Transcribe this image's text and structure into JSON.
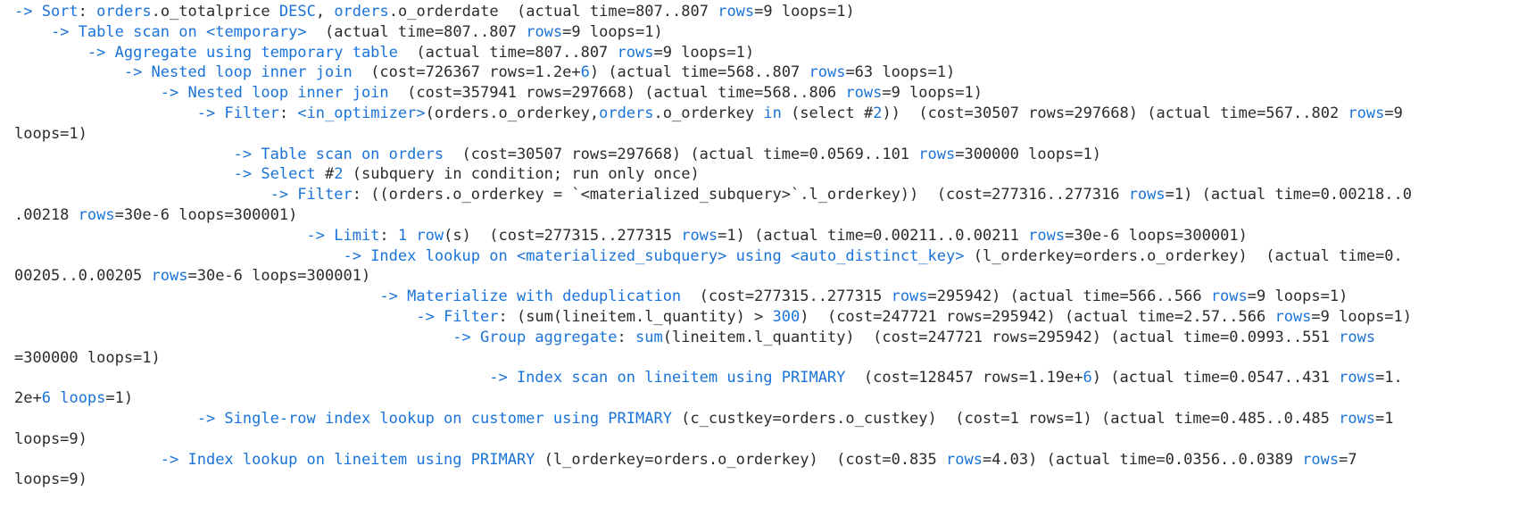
{
  "colors": {
    "text": "#1f1f1f",
    "keyword": "#1a73d9",
    "background": "#ffffff"
  },
  "lines": [
    {
      "indent": 0,
      "segs": [
        {
          "t": "-> ",
          "c": "k"
        },
        {
          "t": "Sort",
          "c": "k"
        },
        {
          "t": ": ",
          "c": "t"
        },
        {
          "t": "orders",
          "c": "k"
        },
        {
          "t": ".o_totalprice ",
          "c": "t"
        },
        {
          "t": "DESC",
          "c": "k"
        },
        {
          "t": ", ",
          "c": "t"
        },
        {
          "t": "orders",
          "c": "k"
        },
        {
          "t": ".o_orderdate  (actual time=807..807 ",
          "c": "t"
        },
        {
          "t": "rows",
          "c": "k"
        },
        {
          "t": "=9 loops=1)",
          "c": "t"
        }
      ]
    },
    {
      "indent": 4,
      "segs": [
        {
          "t": "-> ",
          "c": "k"
        },
        {
          "t": "Table scan on ",
          "c": "k"
        },
        {
          "t": "<temporary>",
          "c": "k"
        },
        {
          "t": "  (actual time=807..807 ",
          "c": "t"
        },
        {
          "t": "rows",
          "c": "k"
        },
        {
          "t": "=9 loops=1)",
          "c": "t"
        }
      ]
    },
    {
      "indent": 8,
      "segs": [
        {
          "t": "-> ",
          "c": "k"
        },
        {
          "t": "Aggregate using temporary table",
          "c": "k"
        },
        {
          "t": "  (actual time=807..807 ",
          "c": "t"
        },
        {
          "t": "rows",
          "c": "k"
        },
        {
          "t": "=9 loops=1)",
          "c": "t"
        }
      ]
    },
    {
      "indent": 12,
      "segs": [
        {
          "t": "-> ",
          "c": "k"
        },
        {
          "t": "Nested loop inner join",
          "c": "k"
        },
        {
          "t": "  (cost=726367 rows=1.2e+",
          "c": "t"
        },
        {
          "t": "6",
          "c": "k"
        },
        {
          "t": ") (actual time=568..807 ",
          "c": "t"
        },
        {
          "t": "rows",
          "c": "k"
        },
        {
          "t": "=63 loops=1)",
          "c": "t"
        }
      ]
    },
    {
      "indent": 16,
      "segs": [
        {
          "t": "-> ",
          "c": "k"
        },
        {
          "t": "Nested loop inner join",
          "c": "k"
        },
        {
          "t": "  (cost=357941 rows=297668) (actual time=568..806 ",
          "c": "t"
        },
        {
          "t": "rows",
          "c": "k"
        },
        {
          "t": "=9 loops=1)",
          "c": "t"
        }
      ]
    },
    {
      "indent": 20,
      "segs": [
        {
          "t": "-> ",
          "c": "k"
        },
        {
          "t": "Filter",
          "c": "k"
        },
        {
          "t": ": ",
          "c": "t"
        },
        {
          "t": "<in_optimizer>",
          "c": "k"
        },
        {
          "t": "(orders.o_orderkey,",
          "c": "t"
        },
        {
          "t": "orders",
          "c": "k"
        },
        {
          "t": ".o_orderkey ",
          "c": "t"
        },
        {
          "t": "in",
          "c": "k"
        },
        {
          "t": " (select #",
          "c": "t"
        },
        {
          "t": "2",
          "c": "n"
        },
        {
          "t": "))  (cost=30507 rows=297668) (actual time=567..802 ",
          "c": "t"
        },
        {
          "t": "rows",
          "c": "k"
        },
        {
          "t": "=9",
          "c": "t"
        }
      ]
    },
    {
      "indent": 0,
      "segs": [
        {
          "t": "loops=1)",
          "c": "t"
        }
      ]
    },
    {
      "indent": 24,
      "segs": [
        {
          "t": "-> ",
          "c": "k"
        },
        {
          "t": "Table scan on orders",
          "c": "k"
        },
        {
          "t": "  (cost=30507 rows=297668) (actual time=0.0569..101 ",
          "c": "t"
        },
        {
          "t": "rows",
          "c": "k"
        },
        {
          "t": "=300000 loops=1)",
          "c": "t"
        }
      ]
    },
    {
      "indent": 24,
      "segs": [
        {
          "t": "-> ",
          "c": "k"
        },
        {
          "t": "Select",
          "c": "k"
        },
        {
          "t": " #",
          "c": "t"
        },
        {
          "t": "2",
          "c": "n"
        },
        {
          "t": " (subquery in condition; run only once)",
          "c": "t"
        }
      ]
    },
    {
      "indent": 28,
      "segs": [
        {
          "t": "-> ",
          "c": "k"
        },
        {
          "t": "Filter",
          "c": "k"
        },
        {
          "t": ": ((orders.o_orderkey = `<materialized_subquery>`.l_orderkey))  (cost=277316..277316 ",
          "c": "t"
        },
        {
          "t": "rows",
          "c": "k"
        },
        {
          "t": "=1) (actual time=0.00218..0",
          "c": "t"
        }
      ]
    },
    {
      "indent": 0,
      "segs": [
        {
          "t": ".00218 ",
          "c": "t"
        },
        {
          "t": "rows",
          "c": "k"
        },
        {
          "t": "=30e-6 loops=300001)",
          "c": "t"
        }
      ]
    },
    {
      "indent": 32,
      "segs": [
        {
          "t": "-> ",
          "c": "k"
        },
        {
          "t": "Limit",
          "c": "k"
        },
        {
          "t": ": ",
          "c": "t"
        },
        {
          "t": "1 row",
          "c": "k"
        },
        {
          "t": "(s)  (cost=277315..277315 ",
          "c": "t"
        },
        {
          "t": "rows",
          "c": "k"
        },
        {
          "t": "=1) (actual time=0.00211..0.00211 ",
          "c": "t"
        },
        {
          "t": "rows",
          "c": "k"
        },
        {
          "t": "=30e-6 loops=300001)",
          "c": "t"
        }
      ]
    },
    {
      "indent": 36,
      "segs": [
        {
          "t": "-> ",
          "c": "k"
        },
        {
          "t": "Index lookup on ",
          "c": "k"
        },
        {
          "t": "<materialized_subquery>",
          "c": "k"
        },
        {
          "t": " using ",
          "c": "k"
        },
        {
          "t": "<auto_distinct_key>",
          "c": "k"
        },
        {
          "t": " (l_orderkey=orders.o_orderkey)  (actual time=0.",
          "c": "t"
        }
      ]
    },
    {
      "indent": 0,
      "segs": [
        {
          "t": "00205..0.00205 ",
          "c": "t"
        },
        {
          "t": "rows",
          "c": "k"
        },
        {
          "t": "=30e-6 loops=300001)",
          "c": "t"
        }
      ]
    },
    {
      "indent": 40,
      "segs": [
        {
          "t": "-> ",
          "c": "k"
        },
        {
          "t": "Materialize with deduplication",
          "c": "k"
        },
        {
          "t": "  (cost=277315..277315 ",
          "c": "t"
        },
        {
          "t": "rows",
          "c": "k"
        },
        {
          "t": "=295942) (actual time=566..566 ",
          "c": "t"
        },
        {
          "t": "rows",
          "c": "k"
        },
        {
          "t": "=9 loops=1)",
          "c": "t"
        }
      ]
    },
    {
      "indent": 44,
      "segs": [
        {
          "t": "-> ",
          "c": "k"
        },
        {
          "t": "Filter",
          "c": "k"
        },
        {
          "t": ": (sum(lineitem.l_quantity) > ",
          "c": "t"
        },
        {
          "t": "300",
          "c": "n"
        },
        {
          "t": ")  (cost=247721 rows=295942) (actual time=2.57..566 ",
          "c": "t"
        },
        {
          "t": "rows",
          "c": "k"
        },
        {
          "t": "=9 loops=1)",
          "c": "t"
        }
      ]
    },
    {
      "indent": 48,
      "segs": [
        {
          "t": "-> ",
          "c": "k"
        },
        {
          "t": "Group aggregate",
          "c": "k"
        },
        {
          "t": ": ",
          "c": "t"
        },
        {
          "t": "sum",
          "c": "k"
        },
        {
          "t": "(lineitem.l_quantity)  (cost=247721 rows=295942) (actual time=0.0993..551 ",
          "c": "t"
        },
        {
          "t": "rows",
          "c": "k"
        }
      ]
    },
    {
      "indent": 0,
      "segs": [
        {
          "t": "=300000 loops=1)",
          "c": "t"
        }
      ]
    },
    {
      "indent": 52,
      "segs": [
        {
          "t": "-> ",
          "c": "k"
        },
        {
          "t": "Index scan on lineitem using PRIMARY",
          "c": "k"
        },
        {
          "t": "  (cost=128457 rows=1.19e+",
          "c": "t"
        },
        {
          "t": "6",
          "c": "k"
        },
        {
          "t": ") (actual time=0.0547..431 ",
          "c": "t"
        },
        {
          "t": "rows",
          "c": "k"
        },
        {
          "t": "=1.",
          "c": "t"
        }
      ]
    },
    {
      "indent": 0,
      "segs": [
        {
          "t": "2e+",
          "c": "t"
        },
        {
          "t": "6",
          "c": "k"
        },
        {
          "t": " ",
          "c": "t"
        },
        {
          "t": "loops",
          "c": "k"
        },
        {
          "t": "=1)",
          "c": "t"
        }
      ]
    },
    {
      "indent": 20,
      "segs": [
        {
          "t": "-> ",
          "c": "k"
        },
        {
          "t": "Single-row index lookup on customer using PRIMARY",
          "c": "k"
        },
        {
          "t": " (c_custkey=orders.o_custkey)  (cost=1 rows=1) (actual time=0.485..0.485 ",
          "c": "t"
        },
        {
          "t": "rows",
          "c": "k"
        },
        {
          "t": "=1",
          "c": "t"
        }
      ]
    },
    {
      "indent": 0,
      "segs": [
        {
          "t": "loops=9)",
          "c": "t"
        }
      ]
    },
    {
      "indent": 16,
      "segs": [
        {
          "t": "-> ",
          "c": "k"
        },
        {
          "t": "Index lookup on lineitem using PRIMARY",
          "c": "k"
        },
        {
          "t": " (l_orderkey=orders.o_orderkey)  (cost=0.835 ",
          "c": "t"
        },
        {
          "t": "rows",
          "c": "k"
        },
        {
          "t": "=4.03) (actual time=0.0356..0.0389 ",
          "c": "t"
        },
        {
          "t": "rows",
          "c": "k"
        },
        {
          "t": "=7",
          "c": "t"
        }
      ]
    },
    {
      "indent": 0,
      "segs": [
        {
          "t": "loops=9)",
          "c": "t"
        }
      ]
    }
  ]
}
